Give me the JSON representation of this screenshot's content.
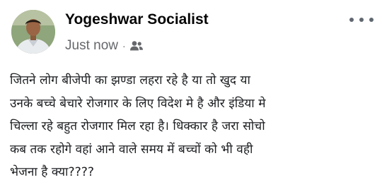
{
  "post": {
    "author_name": "Yogeshwar Socialist",
    "timestamp": "Just now",
    "separator": "·",
    "audience_icon": "friends-icon",
    "more_icon": "more-options-icon",
    "text_lines": [
      "जितने लोग बीजेपी का झण्डा लहरा रहे है या तो खुद या",
      "उनके बच्चे बेचारे रोजगार के लिए विदेश मे है और इंडिया मे",
      "चिल्ला रहे बहुत रोजगार मिल रहा है। धिक्कार है जरा सोचो",
      "कब तक रहोगे वहां आने वाले समय में बच्चों को भी वही",
      "भेजना है क्या????"
    ]
  }
}
